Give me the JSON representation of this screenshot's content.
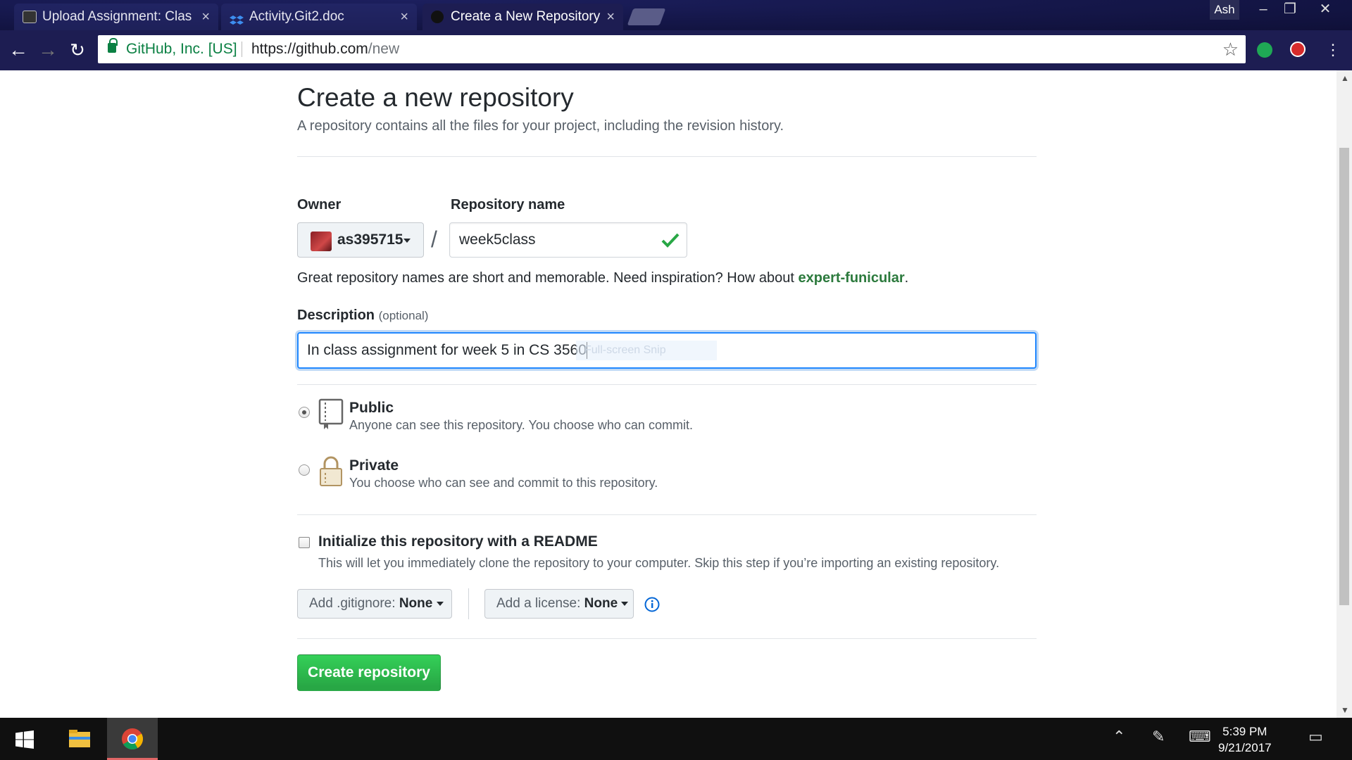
{
  "browser": {
    "tabs": [
      {
        "title": "Upload Assignment: Clas",
        "icon": "blackboard-icon"
      },
      {
        "title": "Activity.Git2.doc",
        "icon": "dropbox-icon"
      },
      {
        "title": "Create a New Repository",
        "icon": "github-icon"
      }
    ],
    "profile_name": "Ash",
    "omnibox": {
      "org": "GitHub, Inc. [US]",
      "url_host": "https://github.com",
      "url_path": "/new"
    }
  },
  "page": {
    "title": "Create a new repository",
    "subtitle": "A repository contains all the files for your project, including the revision history.",
    "owner_label": "Owner",
    "owner_value": "as395715",
    "slash": "/",
    "repo_name_label": "Repository name",
    "repo_name_value": "week5class",
    "hint_prefix": "Great repository names are short and memorable. Need inspiration? How about ",
    "hint_suggestion": "expert-funicular",
    "hint_suffix": ".",
    "description_label": "Description",
    "description_optional": "(optional)",
    "description_value": "In class assignment for week 5 in CS 3560",
    "snip_overlay": "Full-screen Snip",
    "visibility": [
      {
        "title": "Public",
        "note": "Anyone can see this repository. You choose who can commit.",
        "selected": true
      },
      {
        "title": "Private",
        "note": "You choose who can see and commit to this repository.",
        "selected": false
      }
    ],
    "init_readme_title": "Initialize this repository with a README",
    "init_readme_note": "This will let you immediately clone the repository to your computer. Skip this step if you’re importing an existing repository.",
    "gitignore_label": "Add .gitignore:",
    "gitignore_value": "None",
    "license_label": "Add a license:",
    "license_value": "None",
    "create_button": "Create repository"
  },
  "taskbar": {
    "time": "5:39 PM",
    "date": "9/21/2017"
  },
  "colors": {
    "browser_frame": "#1d1d52",
    "accent_green": "#28a745",
    "focus_blue": "#2188ff"
  }
}
